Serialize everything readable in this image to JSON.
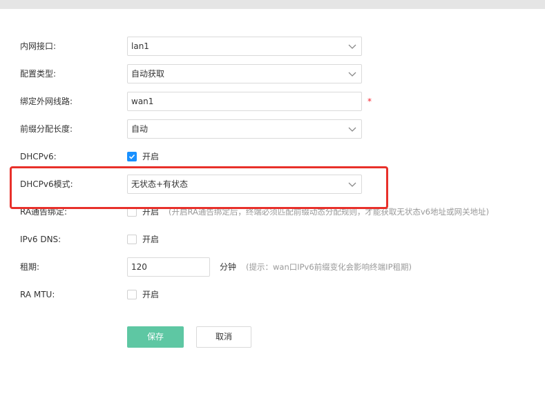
{
  "form": {
    "lan_interface": {
      "label": "内网接口:",
      "value": "lan1"
    },
    "config_type": {
      "label": "配置类型:",
      "value": "自动获取"
    },
    "wan_binding": {
      "label": "绑定外网线路:",
      "value": "wan1",
      "required_mark": "*"
    },
    "prefix_length": {
      "label": "前缀分配长度:",
      "value": "自动"
    },
    "dhcpv6": {
      "label": "DHCPv6:",
      "checkbox_label": "开启",
      "checked": true
    },
    "dhcpv6_mode": {
      "label": "DHCPv6模式:",
      "value": "无状态+有状态"
    },
    "ra_binding": {
      "label": "RA通告绑定:",
      "checkbox_label": "开启",
      "checked": false,
      "hint": "(开启RA通告绑定后，终端必须匹配前缀动态分配规则，才能获取无状态v6地址或网关地址)"
    },
    "ipv6_dns": {
      "label": "IPv6 DNS:",
      "checkbox_label": "开启",
      "checked": false
    },
    "lease": {
      "label": "租期:",
      "value": "120",
      "unit": "分钟",
      "hint": "(提示：wan口IPv6前缀变化会影响终端IP租期)"
    },
    "ra_mtu": {
      "label": "RA MTU:",
      "checkbox_label": "开启",
      "checked": false
    }
  },
  "buttons": {
    "save": "保存",
    "cancel": "取消"
  },
  "colors": {
    "primary": "#5ec7a3",
    "checkbox": "#1890ff",
    "highlight": "#e8302a"
  },
  "icons": {
    "dropdown": "chevron-down-icon",
    "check": "checkmark-icon"
  }
}
